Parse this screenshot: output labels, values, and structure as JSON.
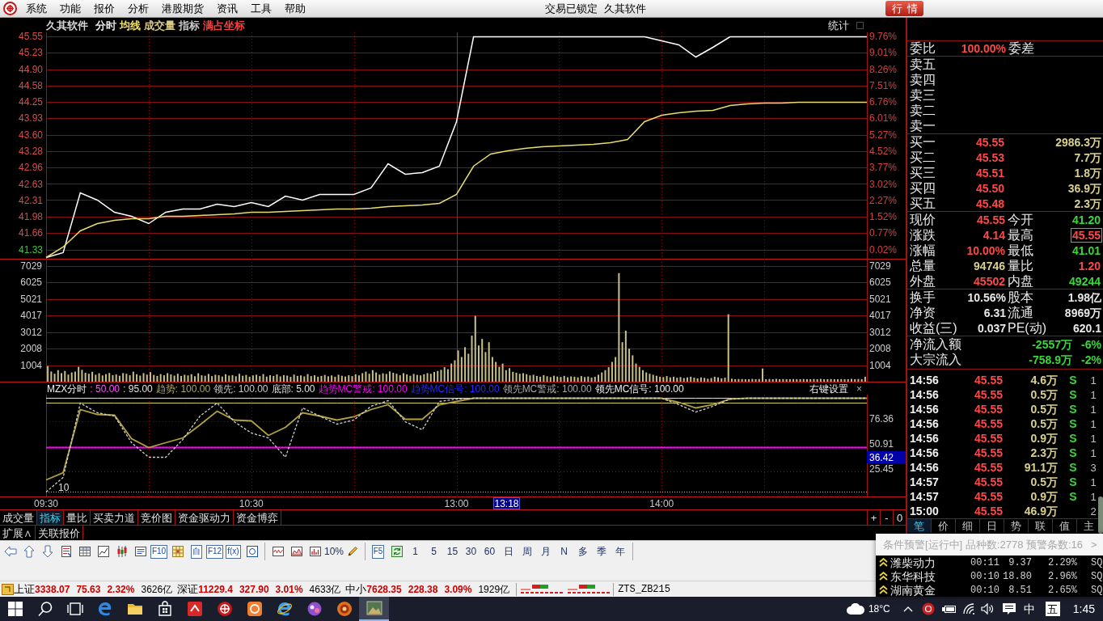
{
  "menu_bar": {
    "menus": [
      "系统",
      "功能",
      "报价",
      "分析",
      "港股期货",
      "资讯",
      "工具",
      "帮助"
    ],
    "status": "交易已锁定",
    "product": "久其软件",
    "quote_button": "行情"
  },
  "chart_header": {
    "items": [
      {
        "text": "久其软件",
        "color": "#d8d8d8"
      },
      {
        "text": "分时",
        "color": "#e8e8e8"
      },
      {
        "text": "均线",
        "color": "#f0e068"
      },
      {
        "text": "成交量",
        "color": "#d8c888"
      },
      {
        "text": "指标",
        "color": "#c8c8c8"
      },
      {
        "text": "满占坐标",
        "color": "#ff3c3c"
      }
    ],
    "stats": "统计"
  },
  "price_chart": {
    "left_axis": [
      {
        "color": "#e04848"
      },
      {
        "color": "#e04848"
      },
      {
        "color": "#e04848"
      },
      {
        "color": "#e04848"
      },
      {
        "color": "#e04848"
      },
      {
        "color": "#e04848"
      },
      {
        "color": "#e04848"
      },
      {
        "color": "#e04848"
      },
      {
        "color": "#e04848"
      },
      {
        "color": "#e04848"
      },
      {
        "color": "#e04848"
      },
      {
        "color": "#e04848"
      },
      {
        "color": "#e04848"
      },
      {
        "color": "#38c838"
      }
    ],
    "right_axis": [
      "9.76%",
      "9.01%",
      "8.26%",
      "7.51%",
      "6.76%",
      "6.01%",
      "5.27%",
      "4.52%",
      "3.77%",
      "3.02%",
      "2.27%",
      "1.52%",
      "0.77%",
      "0.02%"
    ],
    "chart_data": {
      "type": "line",
      "categories": [
        null,
        null,
        null,
        null,
        null,
        null,
        null,
        null,
        null,
        null,
        null,
        null,
        null,
        null,
        null,
        null,
        null,
        null,
        null,
        null,
        null,
        null,
        null,
        null,
        null,
        null,
        null,
        null,
        null,
        null,
        null,
        null,
        null,
        null,
        null,
        null,
        null,
        null,
        null,
        null,
        null,
        null,
        null,
        null,
        null,
        null,
        null,
        null,
        null
      ],
      "ylim": [
        41.15,
        45.63
      ],
      "grid": true,
      "yticks": [
        {
          "value": 45.55,
          "label": "45.55"
        },
        {
          "value": 45.23,
          "label": "45.23"
        },
        {
          "value": 44.9,
          "label": "44.90"
        },
        {
          "value": 44.58,
          "label": "44.58"
        },
        {
          "value": 44.25,
          "label": "44.25"
        },
        {
          "value": 43.93,
          "label": "43.93"
        },
        {
          "value": 43.6,
          "label": "43.60"
        },
        {
          "value": 43.28,
          "label": "43.28"
        },
        {
          "value": 42.96,
          "label": "42.96"
        },
        {
          "value": 42.63,
          "label": "42.63"
        },
        {
          "value": 42.31,
          "label": "42.31"
        },
        {
          "value": 41.98,
          "label": "41.98"
        },
        {
          "value": 41.66,
          "label": "41.66"
        },
        {
          "value": 41.33,
          "label": "41.33"
        }
      ],
      "series": [
        {
          "color": "#ffffff",
          "values": [
            41.19,
            41.28,
            42.46,
            42.31,
            42.08,
            41.99,
            41.85,
            42.08,
            42.15,
            42.15,
            42.24,
            42.19,
            42.27,
            42.19,
            42.4,
            42.31,
            42.43,
            42.43,
            42.43,
            42.56,
            43.04,
            42.83,
            42.86,
            42.99,
            43.87,
            45.55,
            45.55,
            45.55,
            45.55,
            45.55,
            45.55,
            45.55,
            45.55,
            45.55,
            45.55,
            45.55,
            45.47,
            45.39,
            45.15,
            45.34,
            45.55,
            45.55,
            45.55,
            45.55,
            45.55,
            45.55,
            45.55,
            45.55,
            45.55
          ]
        },
        {
          "color": "#e8dc70",
          "values": [
            41.19,
            41.39,
            41.71,
            41.86,
            41.92,
            41.95,
            41.95,
            41.99,
            42.0,
            42.02,
            42.03,
            42.05,
            42.07,
            42.08,
            42.1,
            42.11,
            42.13,
            42.15,
            42.15,
            42.16,
            42.19,
            42.21,
            42.22,
            42.26,
            42.43,
            42.99,
            43.23,
            43.3,
            43.34,
            43.38,
            43.39,
            43.41,
            43.42,
            43.46,
            43.52,
            43.87,
            44.0,
            44.05,
            44.08,
            44.1,
            44.19,
            44.22,
            44.24,
            44.24,
            44.26,
            44.26,
            44.26,
            44.26,
            44.26
          ]
        }
      ]
    }
  },
  "volume_chart": {
    "right_axis": [
      "7029",
      "6025",
      "5021",
      "4017",
      "3012",
      "2008",
      "1004"
    ],
    "chart_data": {
      "type": "bar",
      "ylim": [
        0,
        7474
      ],
      "grid": true,
      "yticks": [
        {
          "value": 7029,
          "label": "7029"
        },
        {
          "value": 6025,
          "label": "6025"
        },
        {
          "value": 5021,
          "label": "5021"
        },
        {
          "value": 4017,
          "label": "4017"
        },
        {
          "value": 3012,
          "label": "3012"
        },
        {
          "value": 2008,
          "label": "2008"
        },
        {
          "value": 1004,
          "label": "1004"
        }
      ],
      "categories": [
        null,
        null,
        null,
        null,
        null,
        null,
        null,
        null,
        null,
        null,
        null,
        null,
        null,
        null,
        null,
        null,
        null,
        null,
        null,
        null,
        null,
        null,
        null,
        null,
        null,
        null,
        null,
        null,
        null,
        null,
        null,
        null,
        null,
        null,
        null,
        null,
        null,
        null,
        null,
        null,
        null,
        null,
        null,
        null,
        null,
        null,
        null,
        null,
        null,
        null,
        null,
        null,
        null,
        null,
        null,
        null,
        null,
        null,
        null,
        null,
        null,
        null,
        null,
        null,
        null,
        null,
        null,
        null,
        null,
        null,
        null,
        null,
        null,
        null,
        null,
        null,
        null,
        null,
        null,
        null,
        null,
        null,
        null,
        null,
        null,
        null,
        null,
        null,
        null,
        null,
        null,
        null,
        null,
        null,
        null,
        null,
        null,
        null,
        null,
        null,
        null,
        null,
        null,
        null,
        null,
        null,
        null,
        null,
        null,
        null,
        null,
        null,
        null,
        null,
        null,
        null,
        null,
        null,
        null,
        null,
        null,
        null,
        null,
        null,
        null,
        null,
        null,
        null,
        null,
        null,
        null,
        null,
        null,
        null,
        null,
        null,
        null,
        null,
        null,
        null,
        null,
        null,
        null,
        null,
        null,
        null,
        null,
        null,
        null,
        null,
        null,
        null,
        null,
        null,
        null,
        null,
        null,
        null,
        null,
        null,
        null,
        null,
        null,
        null,
        null,
        null,
        null,
        null,
        null,
        null,
        null,
        null,
        null,
        null,
        null,
        null,
        null,
        null,
        null,
        null,
        null,
        null,
        null,
        null,
        null,
        null,
        null,
        null,
        null,
        null,
        null,
        null,
        null,
        null,
        null,
        null,
        null,
        null,
        null,
        null,
        null,
        null,
        null,
        null,
        null,
        null,
        null,
        null,
        null,
        null,
        null,
        null,
        null,
        null,
        null,
        null,
        null,
        null,
        null,
        null,
        null,
        null,
        null,
        null,
        null,
        null,
        null,
        null,
        null,
        null,
        null,
        null,
        null,
        null,
        null,
        null,
        null,
        null,
        null,
        null
      ],
      "series": [
        {
          "color": "#c8c088",
          "values": [
            950,
            620,
            480,
            700,
            520,
            650,
            430,
            560,
            610,
            900,
            720,
            540,
            480,
            600,
            420,
            510,
            380,
            460,
            530,
            400,
            440,
            360,
            520,
            480,
            390,
            610,
            450,
            370,
            520,
            430,
            580,
            410,
            350,
            460,
            390,
            520,
            440,
            370,
            480,
            350,
            420,
            380,
            450,
            330,
            510,
            390,
            360,
            470,
            340,
            420,
            390,
            310,
            450,
            370,
            400,
            330,
            480,
            360,
            410,
            300,
            380,
            420,
            340,
            460,
            310,
            390,
            350,
            440,
            320,
            400,
            370,
            290,
            430,
            350,
            380,
            320,
            460,
            340,
            390,
            300,
            350,
            410,
            330,
            380,
            300,
            420,
            360,
            310,
            390,
            340,
            450,
            380,
            520,
            610,
            480,
            700,
            560,
            430,
            510,
            470,
            620,
            540,
            480,
            390,
            520,
            440,
            360,
            470,
            410,
            380,
            450,
            520,
            480,
            590,
            650,
            720,
            880,
            760,
            1100,
            1300,
            1900,
            1500,
            2100,
            1700,
            2800,
            4000,
            2200,
            2600,
            1800,
            2400,
            1500,
            1200,
            900,
            1100,
            700,
            820,
            600,
            540,
            480,
            520,
            450,
            380,
            420,
            350,
            300,
            400,
            330,
            280,
            360,
            310,
            290,
            350,
            270,
            320,
            300,
            260,
            340,
            280,
            310,
            250,
            300,
            420,
            560,
            700,
            880,
            1200,
            1500,
            6600,
            2400,
            3100,
            2000,
            1600,
            1100,
            900,
            700,
            560,
            480,
            420,
            360,
            300,
            280,
            340,
            260,
            300,
            240,
            280,
            220,
            260,
            300,
            240,
            200,
            260,
            230,
            180,
            220,
            300,
            260,
            200,
            240,
            4100,
            180,
            150,
            160,
            160,
            150,
            150,
            170,
            150,
            160,
            800,
            150,
            160,
            150,
            170,
            150,
            160,
            150,
            150,
            160,
            150,
            150,
            160,
            150,
            150,
            160,
            150,
            170,
            150,
            150,
            160,
            150,
            150,
            160,
            150,
            150,
            170,
            150,
            160,
            150,
            300
          ]
        }
      ]
    }
  },
  "indicator": {
    "name": "MZX分时",
    "params": [
      {
        "text": ": 50.00",
        "color": "#ff50ff"
      },
      {
        "text": ": 95.00",
        "color": "#e0e0e0"
      },
      {
        "text": "趋势: 100.00",
        "color": "#b0a868"
      },
      {
        "text": "领先: 100.00",
        "color": "#c8c8c8"
      },
      {
        "text": "底部: 5.00",
        "color": "#e0e0e0"
      },
      {
        "text": "趋势MC警戒: 100.00",
        "color": "#ff00ff"
      },
      {
        "text": "趋势MC信号: 100.00",
        "color": "#2828ff"
      },
      {
        "text": "领先MC警戒: 100.00",
        "color": "#a8a8a8"
      },
      {
        "text": "领先MC信号: 100.00",
        "color": "#f0f0f0"
      }
    ],
    "settings": "右键设置",
    "close": "×",
    "cursor_value": "36.42",
    "cursor_time": "13:18",
    "chart_data": {
      "type": "line",
      "categories": [
        "09:30",
        null,
        null,
        null,
        null,
        null,
        null,
        null,
        null,
        null,
        null,
        null,
        "10:30",
        null,
        null,
        null,
        null,
        null,
        null,
        null,
        null,
        null,
        null,
        null,
        "13:00",
        null,
        null,
        null,
        null,
        null,
        null,
        null,
        null,
        null,
        null,
        null,
        "14:00",
        null,
        null,
        null,
        null,
        null,
        null,
        null,
        null,
        null,
        null,
        null,
        null
      ],
      "ylim": [
        0,
        103.46
      ],
      "grid": true,
      "yticks": [
        {
          "value": 76.36,
          "label": "76.36"
        },
        {
          "value": 50.91,
          "label": "50.91"
        },
        {
          "value": 25.45,
          "label": "25.45"
        }
      ],
      "series": [
        {
          "color": "#e0e0e0",
          "line_style": "solid",
          "values": [
            100,
            100,
            100,
            100,
            100,
            100,
            100,
            100,
            100,
            100,
            100,
            100,
            100,
            100,
            100,
            100,
            100,
            100,
            100,
            100,
            100,
            100,
            100,
            100,
            100,
            100,
            100,
            100,
            100,
            100,
            100,
            100,
            100,
            100,
            100,
            100,
            100,
            100,
            100,
            100,
            100,
            100,
            100,
            100,
            100,
            100,
            100,
            100,
            100
          ]
        },
        {
          "color": "#d8d070",
          "line_style": "solid",
          "values": [
            95,
            95,
            95,
            95,
            95,
            95,
            95,
            95,
            95,
            95,
            95,
            95,
            95,
            95,
            95,
            95,
            95,
            95,
            95,
            95,
            95,
            95,
            95,
            95,
            95,
            95,
            95,
            95,
            95,
            95,
            95,
            95,
            95,
            95,
            95,
            95,
            95,
            95,
            95,
            95,
            95,
            95,
            95,
            95,
            95,
            95,
            95,
            95,
            95
          ]
        },
        {
          "color": "#ff00ff",
          "line_style": "solid",
          "values": [
            50,
            50,
            50,
            50,
            50,
            50,
            50,
            50,
            50,
            50,
            50,
            50,
            50,
            50,
            50,
            50,
            50,
            50,
            50,
            50,
            50,
            50,
            50,
            50,
            50,
            50,
            50,
            50,
            50,
            50,
            50,
            50,
            50,
            50,
            50,
            50,
            50,
            50,
            50,
            50,
            50,
            50,
            50,
            50,
            50,
            50,
            50,
            50,
            50
          ]
        },
        {
          "color": "#c0c0c0",
          "line_style": "dotted",
          "values": [
            5,
            5,
            5,
            5,
            5,
            5,
            5,
            5,
            5,
            5,
            5,
            5,
            5,
            5,
            5,
            5,
            5,
            5,
            5,
            5,
            5,
            5,
            5,
            5,
            5,
            5,
            5,
            5,
            5,
            5,
            5,
            5,
            5,
            5,
            5,
            5,
            5,
            5,
            5,
            5,
            5,
            5,
            5,
            5,
            5,
            5,
            5,
            5,
            5
          ]
        },
        {
          "color": "#b0a040",
          "line_style": "solid",
          "values": [
            17,
            25,
            89,
            84,
            83,
            59,
            50,
            55,
            60,
            73,
            87,
            78,
            77,
            62,
            71,
            85,
            82,
            78,
            81,
            89,
            94,
            79,
            79,
            94,
            97,
            100,
            100,
            100,
            100,
            100,
            100,
            100,
            100,
            100,
            100,
            100,
            100,
            96,
            90,
            94,
            99,
            100,
            100,
            100,
            100,
            100,
            100,
            100,
            100
          ]
        },
        {
          "color": "#d0d0d0",
          "line_style": "dashed",
          "values": [
            5,
            20,
            95,
            85,
            82,
            55,
            40,
            40,
            58,
            82,
            95,
            76,
            65,
            60,
            40,
            90,
            82,
            74,
            78,
            92,
            98,
            76,
            68,
            97,
            99,
            100,
            100,
            100,
            100,
            100,
            100,
            100,
            100,
            100,
            100,
            100,
            100,
            94,
            86,
            92,
            99,
            100,
            100,
            100,
            100,
            100,
            100,
            100,
            100
          ]
        }
      ],
      "annotations": [
        "10"
      ]
    }
  },
  "bottom_tabs": [
    {
      "label": "成交量",
      "selected": false
    },
    {
      "label": "指标",
      "selected": true
    },
    {
      "label": "量比",
      "selected": false
    },
    {
      "label": "买卖力道",
      "selected": false
    },
    {
      "label": "竞价图",
      "selected": false
    },
    {
      "label": "资金驱动力",
      "selected": false
    },
    {
      "label": "资金博弈",
      "selected": false
    }
  ],
  "zoom_buttons": [
    "+",
    "-",
    "0"
  ],
  "extension_row": [
    "扩展∧",
    "关联报价"
  ],
  "quote_panel": {
    "ratio": {
      "label": "委比",
      "value": "100.00%",
      "label2": "委差"
    },
    "asks": [
      "卖五",
      "卖四",
      "卖三",
      "卖二",
      "卖一"
    ],
    "bids": [
      {
        "label": "买一",
        "price": "45.55",
        "volume": "2986.3万"
      },
      {
        "label": "买二",
        "price": "45.53",
        "volume": "7.7万"
      },
      {
        "label": "买三",
        "price": "45.51",
        "volume": "1.8万"
      },
      {
        "label": "买四",
        "price": "45.50",
        "volume": "36.9万"
      },
      {
        "label": "买五",
        "price": "45.48",
        "volume": "2.3万"
      }
    ],
    "stats": [
      {
        "label": "现价",
        "value": "45.55",
        "color": "#ff4848",
        "boxed": false
      },
      {
        "label": "今开",
        "value": "41.20",
        "color": "#38d838",
        "boxed": false
      },
      {
        "label": "涨跌",
        "value": "4.14",
        "color": "#ff4848",
        "boxed": false
      },
      {
        "label": "最高",
        "value": "45.55",
        "color": "#ff4848",
        "boxed": true
      },
      {
        "label": "涨幅",
        "value": "10.00%",
        "color": "#ff4848",
        "boxed": false
      },
      {
        "label": "最低",
        "value": "41.01",
        "color": "#38d838",
        "boxed": false
      },
      {
        "label": "总量",
        "value": "94746",
        "color": "#d8d090",
        "boxed": false
      },
      {
        "label": "量比",
        "value": "1.20",
        "color": "#ff4848",
        "boxed": false
      },
      {
        "label": "外盘",
        "value": "45502",
        "color": "#ff4848",
        "boxed": false
      },
      {
        "label": "内盘",
        "value": "49244",
        "color": "#38d838",
        "boxed": false
      }
    ],
    "fundamentals": [
      {
        "label": "换手",
        "value": "10.56%",
        "label2": "股本",
        "value2": "1.98亿"
      },
      {
        "label": "净资",
        "value": "6.31",
        "label2": "流通",
        "value2": "8969万"
      },
      {
        "label": "收益(三)",
        "value": "0.037",
        "label2": "PE(动)",
        "value2": "620.1"
      }
    ],
    "flows": [
      {
        "label": "净流入额",
        "value": "-2557万",
        "pct": "-6%"
      },
      {
        "label": "大宗流入",
        "value": "-758.9万",
        "pct": "-2%"
      }
    ]
  },
  "ticks": [
    {
      "time": "14:56",
      "price": "45.55",
      "volume": "4.6万",
      "side": "S",
      "count": "1"
    },
    {
      "time": "14:56",
      "price": "45.55",
      "volume": "0.5万",
      "side": "S",
      "count": "1"
    },
    {
      "time": "14:56",
      "price": "45.55",
      "volume": "0.5万",
      "side": "S",
      "count": "1"
    },
    {
      "time": "14:56",
      "price": "45.55",
      "volume": "0.5万",
      "side": "S",
      "count": "1"
    },
    {
      "time": "14:56",
      "price": "45.55",
      "volume": "0.9万",
      "side": "S",
      "count": "1"
    },
    {
      "time": "14:56",
      "price": "45.55",
      "volume": "2.3万",
      "side": "S",
      "count": "1"
    },
    {
      "time": "14:56",
      "price": "45.55",
      "volume": "91.1万",
      "side": "S",
      "count": "3"
    },
    {
      "time": "14:57",
      "price": "45.55",
      "volume": "0.5万",
      "side": "S",
      "count": "1"
    },
    {
      "time": "14:57",
      "price": "45.55",
      "volume": "0.9万",
      "side": "S",
      "count": "1"
    },
    {
      "time": "15:00",
      "price": "45.55",
      "volume": "46.9万",
      "count": "2"
    }
  ],
  "detail_tabs": [
    {
      "label": "笔",
      "selected": true
    },
    {
      "label": "价",
      "selected": false
    },
    {
      "label": "细",
      "selected": false
    },
    {
      "label": "日",
      "selected": false
    },
    {
      "label": "势",
      "selected": false
    },
    {
      "label": "联",
      "selected": false
    },
    {
      "label": "值",
      "selected": false
    },
    {
      "label": "主",
      "selected": false
    }
  ],
  "toolbar": {
    "items": [
      {
        "kind": "icon"
      },
      {
        "kind": "icon"
      },
      {
        "kind": "icon"
      },
      {
        "kind": "icon"
      },
      {
        "kind": "icon"
      },
      {
        "kind": "icon"
      },
      {
        "kind": "icon"
      },
      {
        "kind": "icon"
      },
      {
        "kind": "boxed",
        "text": "F10"
      },
      {
        "kind": "icon"
      },
      {
        "kind": "boxed",
        "text": "自"
      },
      {
        "kind": "boxed",
        "text": "F12"
      },
      {
        "kind": "boxed",
        "text": "f(x)"
      },
      {
        "kind": "icon"
      },
      {
        "kind": "separator"
      },
      {
        "kind": "icon"
      },
      {
        "kind": "icon"
      },
      {
        "kind": "icon"
      },
      {
        "kind": "plain",
        "text": "10%"
      },
      {
        "kind": "icon"
      },
      {
        "kind": "separator"
      },
      {
        "kind": "boxed",
        "text": "F5"
      },
      {
        "kind": "icon"
      },
      {
        "kind": "plain",
        "text": "1"
      },
      {
        "kind": "plain",
        "text": "5"
      },
      {
        "kind": "plain",
        "text": "15"
      },
      {
        "kind": "plain",
        "text": "30"
      },
      {
        "kind": "plain",
        "text": "60"
      },
      {
        "kind": "plain",
        "text": "日"
      },
      {
        "kind": "plain",
        "text": "周"
      },
      {
        "kind": "plain",
        "text": "月"
      },
      {
        "kind": "plain",
        "text": "N"
      },
      {
        "kind": "plain",
        "text": "多"
      },
      {
        "kind": "plain",
        "text": "季"
      },
      {
        "kind": "plain",
        "text": "年"
      },
      {
        "kind": "separator"
      }
    ]
  },
  "status_bar": {
    "indices": [
      {
        "name": "上证",
        "value": "3338.07",
        "change": "75.63",
        "pct": "2.32%",
        "amount": "3626亿"
      },
      {
        "name": "深证",
        "value": "11229.4",
        "change": "327.90",
        "pct": "3.01%",
        "amount": "4633亿"
      },
      {
        "name": "中小",
        "value": "7628.35",
        "change": "228.38",
        "pct": "3.09%",
        "amount": "1929亿"
      }
    ],
    "tag": "ZTS_ZB215"
  },
  "alert_popup": {
    "title": "条件预警[运行中] 品种数:2778 预警条数:16",
    "more": ">",
    "rows": [
      {
        "name": "潍柴动力",
        "time": "00:11",
        "price": "9.37",
        "change": "2.29%",
        "code": "SQ"
      },
      {
        "name": "东华科技",
        "time": "00:10",
        "price": "18.80",
        "change": "2.96%",
        "code": "SQ"
      },
      {
        "name": "湖南黄金",
        "time": "00:10",
        "price": "8.51",
        "change": "2.65%",
        "code": "SQ"
      }
    ]
  },
  "taskbar": {
    "apps": [
      {
        "selected": false
      },
      {
        "selected": false
      },
      {
        "selected": false
      },
      {
        "selected": false
      },
      {
        "selected": false
      },
      {
        "selected": false
      },
      {
        "selected": false
      },
      {
        "selected": false
      },
      {
        "selected": false
      },
      {
        "selected": false
      },
      {
        "selected": false
      },
      {
        "selected": false
      },
      {
        "selected": true
      }
    ],
    "temperature": "18°C",
    "ime": "中",
    "ime_mode": "五",
    "time": "1:45"
  }
}
